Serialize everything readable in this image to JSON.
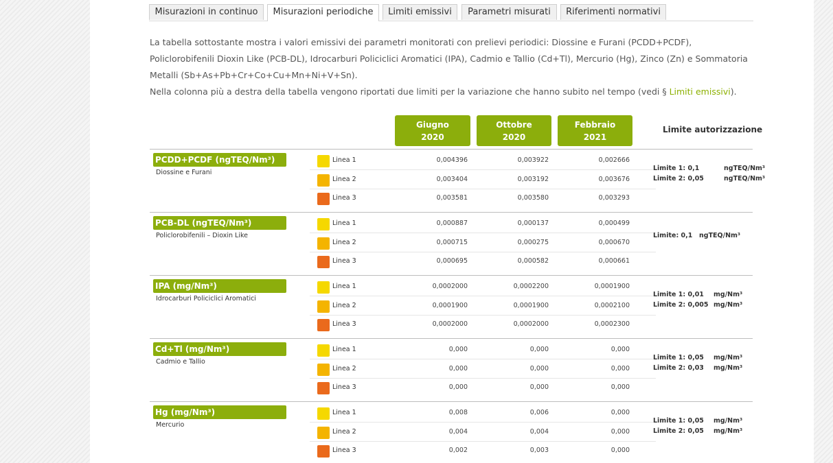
{
  "tabs": [
    {
      "label": "Misurazioni in continuo",
      "active": false
    },
    {
      "label": "Misurazioni periodiche",
      "active": true
    },
    {
      "label": "Limiti emissivi",
      "active": false
    },
    {
      "label": "Parametri misurati",
      "active": false
    },
    {
      "label": "Riferimenti normativi",
      "active": false
    }
  ],
  "intro": {
    "p1": "La tabella sottostante mostra i valori emissivi dei parametri monitorati con prelievi periodici: Diossine e Furani (PCDD+PCDF), Policlorobifenili Dioxin Like (PCB-DL), Idrocarburi Policiclici Aromatici (IPA), Cadmio e Tallio (Cd+Tl), Mercurio (Hg), Zinco (Zn) e Sommatoria Metalli (Sb+As+Pb+Cr+Co+Cu+Mn+Ni+V+Sn).",
    "p2_before": "Nella colonna più a destra della tabella vengono riportati due limiti per la variazione che hanno subito nel tempo (vedi § ",
    "p2_link": "Limiti emissivi",
    "p2_after": ")."
  },
  "columns": [
    {
      "line1": "Giugno",
      "line2": "2020"
    },
    {
      "line1": "Ottobre",
      "line2": "2020"
    },
    {
      "line1": "Febbraio",
      "line2": "2021"
    }
  ],
  "limit_header": "Limite autorizzazione",
  "lines": [
    {
      "name": "Linea 1",
      "color": "#f5d800"
    },
    {
      "name": "Linea 2",
      "color": "#f4b400"
    },
    {
      "name": "Linea 3",
      "color": "#ea6a1c"
    }
  ],
  "parameters": [
    {
      "label": "PCDD+PCDF (ngTEQ/Nm³)",
      "subtitle": "Diossine e Furani",
      "values": [
        [
          "0,004396",
          "0,003922",
          "0,002666"
        ],
        [
          "0,003404",
          "0,003192",
          "0,003676"
        ],
        [
          "0,003581",
          "0,003580",
          "0,003293"
        ]
      ],
      "limits": [
        {
          "text": "Limite 1: 0,1",
          "unit": "ngTEQ/Nm³"
        },
        {
          "text": "Limite 2: 0,05",
          "unit": "ngTEQ/Nm³"
        }
      ]
    },
    {
      "label": "PCB-DL (ngTEQ/Nm³)",
      "subtitle": "Policlorobifenili – Dioxin Like",
      "values": [
        [
          "0,000887",
          "0,000137",
          "0,000499"
        ],
        [
          "0,000715",
          "0,000275",
          "0,000670"
        ],
        [
          "0,000695",
          "0,000582",
          "0,000661"
        ]
      ],
      "limits": [
        {
          "text": "Limite: 0,1",
          "unit": "ngTEQ/Nm³"
        }
      ]
    },
    {
      "label": "IPA (mg/Nm³)",
      "subtitle": "Idrocarburi Policiclici Aromatici",
      "values": [
        [
          "0,0002000",
          "0,0002200",
          "0,0001900"
        ],
        [
          "0,0001900",
          "0,0001900",
          "0,0002100"
        ],
        [
          "0,0002000",
          "0,0002000",
          "0,0002300"
        ]
      ],
      "limits": [
        {
          "text": "Limite 1: 0,01",
          "unit": "mg/Nm³"
        },
        {
          "text": "Limite 2: 0,005",
          "unit": "mg/Nm³"
        }
      ]
    },
    {
      "label": "Cd+Tl (mg/Nm³)",
      "subtitle": "Cadmio e Tallio",
      "values": [
        [
          "0,000",
          "0,000",
          "0,000"
        ],
        [
          "0,000",
          "0,000",
          "0,000"
        ],
        [
          "0,000",
          "0,000",
          "0,000"
        ]
      ],
      "limits": [
        {
          "text": "Limite 1: 0,05",
          "unit": "mg/Nm³"
        },
        {
          "text": "Limite 2: 0,03",
          "unit": "mg/Nm³"
        }
      ]
    },
    {
      "label": "Hg (mg/Nm³)",
      "subtitle": "Mercurio",
      "values": [
        [
          "0,008",
          "0,006",
          "0,000"
        ],
        [
          "0,004",
          "0,004",
          "0,000"
        ],
        [
          "0,002",
          "0,003",
          "0,000"
        ]
      ],
      "limits": [
        {
          "text": "Limite 1: 0,05",
          "unit": "mg/Nm³"
        },
        {
          "text": "Limite 2: 0,05",
          "unit": "mg/Nm³"
        }
      ]
    }
  ]
}
